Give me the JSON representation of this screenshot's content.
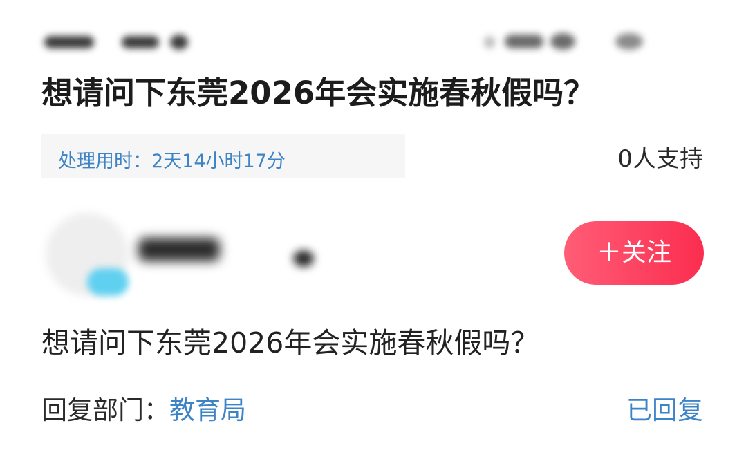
{
  "post": {
    "title": "想请问下东莞2026年会实施春秋假吗？",
    "processing_time": "处理用时：2天14小时17分",
    "support_count": "0人支持",
    "question": "想请问下东莞2026年会实施春秋假吗？"
  },
  "author": {
    "follow_label": "＋关注"
  },
  "reply": {
    "dept_label": "回复部门：",
    "dept_value": "教育局",
    "status": "已回复"
  },
  "colors": {
    "link_blue": "#3d84c7",
    "follow_red": "#fb2d4f",
    "time_bg": "#f6f6f6"
  }
}
